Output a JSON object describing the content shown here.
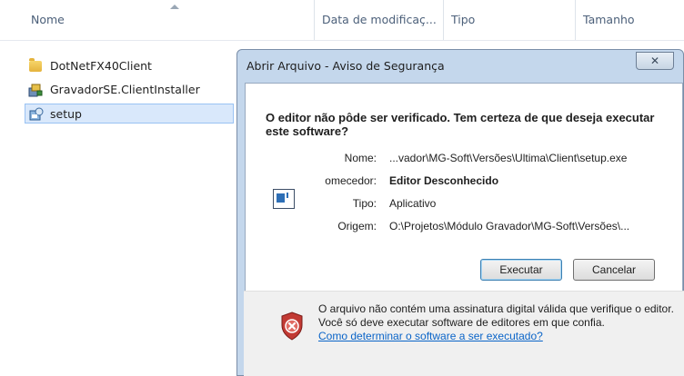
{
  "explorer": {
    "columns": {
      "name": "Nome",
      "date": "Data de modificaç...",
      "type": "Tipo",
      "size": "Tamanho"
    },
    "files": [
      {
        "name": "DotNetFX40Client",
        "icon": "folder-icon"
      },
      {
        "name": "GravadorSE.ClientInstaller",
        "icon": "installer-icon"
      },
      {
        "name": "setup",
        "icon": "setup-icon",
        "selected": true
      }
    ]
  },
  "dialog": {
    "title": "Abrir Arquivo - Aviso de Segurança",
    "close_label": "✕",
    "question": "O editor não pôde ser verificado. Tem certeza de que deseja executar este software?",
    "fields": {
      "name_label": "Nome:",
      "name_value": "...vador\\MG-Soft\\Versões\\Ultima\\Client\\setup.exe",
      "publisher_label": "omecedor:",
      "publisher_value": "Editor Desconhecido",
      "type_label": "Tipo:",
      "type_value": "Aplicativo",
      "origin_label": "Origem:",
      "origin_value": "O:\\Projetos\\Módulo Gravador\\MG-Soft\\Versões\\..."
    },
    "buttons": {
      "run": "Executar",
      "cancel": "Cancelar"
    },
    "warning": {
      "text": "O arquivo não contém uma assinatura digital válida que verifique o editor. Você só deve executar software de editores em que confia.",
      "link": "Como determinar o software a ser executado?"
    }
  }
}
